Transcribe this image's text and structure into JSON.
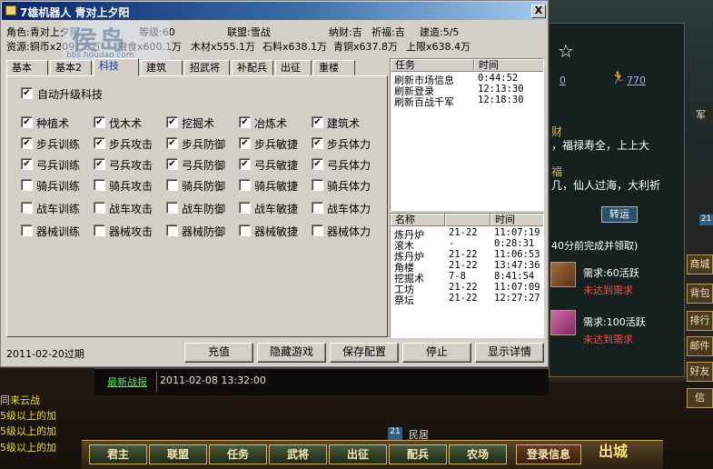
{
  "window": {
    "title": "7雄机器人 青对上夕阳",
    "close_label": "X"
  },
  "info": {
    "role_label": "角色:",
    "role_value": "青对上夕阳",
    "level": "等级:60",
    "alliance": "联盟:雪战",
    "fortune": "纳财:吉",
    "blessing": "祈福:吉",
    "build": "建造:5/5",
    "resources_label": "资源:",
    "copper": "铜币x2091.6万",
    "grain": "粮食x600.1万",
    "wood": "木材x555.1万",
    "stone": "石料x638.1万",
    "bronze": "青铜x637.8万",
    "cap": "上限x638.4万"
  },
  "watermark": {
    "big": "侯岛",
    "small": "bbs.houdao.com"
  },
  "tabs": [
    "基本",
    "基本2",
    "科技",
    "建筑",
    "招武将",
    "补配兵",
    "出征",
    "重楼"
  ],
  "tech": {
    "auto_upgrade": "自动升级科技",
    "rows": [
      [
        {
          "label": "种植术",
          "checked": true
        },
        {
          "label": "伐木术",
          "checked": true
        },
        {
          "label": "挖掘术",
          "checked": true
        },
        {
          "label": "冶炼术",
          "checked": true
        },
        {
          "label": "建筑术",
          "checked": true
        }
      ],
      [
        {
          "label": "步兵训练",
          "checked": true
        },
        {
          "label": "步兵攻击",
          "checked": true
        },
        {
          "label": "步兵防御",
          "checked": true
        },
        {
          "label": "步兵敏捷",
          "checked": true
        },
        {
          "label": "步兵体力",
          "checked": true
        }
      ],
      [
        {
          "label": "弓兵训练",
          "checked": true
        },
        {
          "label": "弓兵攻击",
          "checked": true
        },
        {
          "label": "弓兵防御",
          "checked": true
        },
        {
          "label": "弓兵敏捷",
          "checked": true
        },
        {
          "label": "弓兵体力",
          "checked": true
        }
      ],
      [
        {
          "label": "骑兵训练",
          "checked": false
        },
        {
          "label": "骑兵攻击",
          "checked": false
        },
        {
          "label": "骑兵防御",
          "checked": false
        },
        {
          "label": "骑兵敏捷",
          "checked": false
        },
        {
          "label": "骑兵体力",
          "checked": false
        }
      ],
      [
        {
          "label": "战车训练",
          "checked": false
        },
        {
          "label": "战车攻击",
          "checked": false
        },
        {
          "label": "战车防御",
          "checked": false
        },
        {
          "label": "战车敏捷",
          "checked": false
        },
        {
          "label": "战车体力",
          "checked": false
        }
      ],
      [
        {
          "label": "器械训练",
          "checked": false
        },
        {
          "label": "器械攻击",
          "checked": false
        },
        {
          "label": "器械防御",
          "checked": false
        },
        {
          "label": "器械敏捷",
          "checked": false
        },
        {
          "label": "器械体力",
          "checked": false
        }
      ]
    ]
  },
  "task_list": {
    "headers": [
      "任务",
      "时间"
    ],
    "rows": [
      [
        "刷新市场信息",
        "0:44:52"
      ],
      [
        "刷新登录",
        "12:13:30"
      ],
      [
        "刷新百战千军",
        "12:18:30"
      ]
    ]
  },
  "build_list": {
    "headers": [
      "名称",
      "",
      "时间"
    ],
    "rows": [
      [
        "炼丹炉",
        "21-22",
        "11:07:19"
      ],
      [
        "滚木",
        "-",
        "0:28:31"
      ],
      [
        "炼丹炉",
        "21-22",
        "11:06:53"
      ],
      [
        "角楼",
        "21-22",
        "13:47:36"
      ],
      [
        "挖掘术",
        "7-8",
        "8:41:54"
      ],
      [
        "工坊",
        "21-22",
        "11:07:09"
      ],
      [
        "祭坛",
        "21-22",
        "12:27:27"
      ]
    ]
  },
  "status": "2011-02-20过期",
  "buttons": {
    "recharge": "充值",
    "hide_game": "隐藏游戏",
    "save_config": "保存配置",
    "stop": "停止",
    "show_details": "显示详情"
  },
  "game": {
    "star": "☆",
    "link_0": "0",
    "link_770": "770",
    "blessing_1": "财",
    "blessing_2": "，福禄寿全，上上大",
    "blessing_3": "福",
    "blessing_4": "几，仙人过海，大利祈",
    "go_button": "转运",
    "complete_note": "40分前完成并领取)",
    "need_1": "需求:60活跃",
    "unmet_1": "未达到需求",
    "need_2": "需求:100活跃",
    "unmet_2": "未达到需求",
    "army_tab": "军",
    "side_badge": "21",
    "side_tabs": [
      "商城",
      "背包",
      "排行",
      "邮件",
      "好友",
      "信"
    ],
    "news_label": "最新战报",
    "news_time": "2011-02-08 13:32:00",
    "chat": [
      "同来云战",
      "5级以上的加",
      "5级以上的加",
      "5级以上的加"
    ],
    "map_tag": "21",
    "map_name": "民居",
    "bottom_buttons": [
      "君主",
      "联盟",
      "任务",
      "武将",
      "出征",
      "配兵",
      "农场"
    ],
    "login_info": "登录信息",
    "out_city": "出城"
  }
}
